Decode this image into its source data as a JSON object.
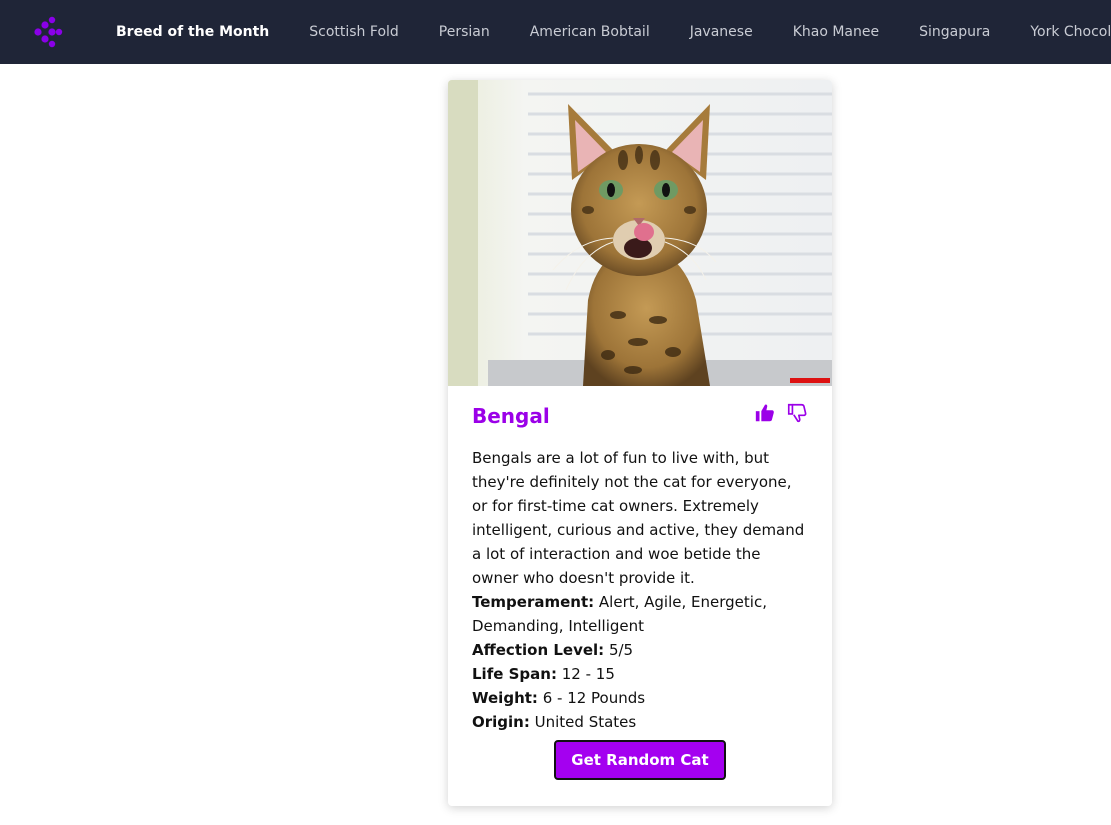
{
  "colors": {
    "navbar_bg": "#1f2537",
    "accent": "#9b00e8",
    "button_bg": "#a400f0"
  },
  "nav": {
    "logo_icon": "dots-network-icon",
    "links": [
      {
        "label": "Breed of the Month",
        "active": true
      },
      {
        "label": "Scottish Fold"
      },
      {
        "label": "Persian"
      },
      {
        "label": "American Bobtail"
      },
      {
        "label": "Javanese"
      },
      {
        "label": "Khao Manee"
      },
      {
        "label": "Singapura"
      },
      {
        "label": "York Chocolate"
      }
    ]
  },
  "card": {
    "image_icon": "cat-photo",
    "name": "Bengal",
    "vote_up_icon": "thumbs-up-icon",
    "vote_down_icon": "thumbs-down-icon",
    "description": "Bengals are a lot of fun to live with, but they're definitely not the cat for everyone, or for first-time cat owners. Extremely intelligent, curious and active, they demand a lot of interaction and woe betide the owner who doesn't provide it.",
    "facts": {
      "temperament_label": "Temperament:",
      "temperament": "Alert, Agile, Energetic, Demanding, Intelligent",
      "affection_label": "Affection Level:",
      "affection": "5/5",
      "lifespan_label": "Life Span:",
      "lifespan": "12 - 15",
      "weight_label": "Weight:",
      "weight": "6 - 12 Pounds",
      "origin_label": "Origin:",
      "origin": "United States"
    },
    "button_label": "Get Random Cat"
  }
}
